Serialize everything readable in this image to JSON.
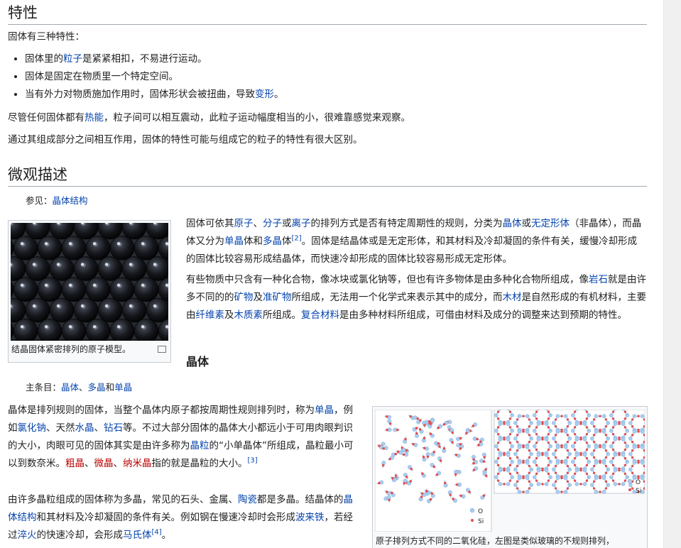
{
  "section_props": {
    "heading": "特性",
    "intro": "固体有三种特性：",
    "bullets": [
      {
        "pre": "固体里的",
        "link": "粒子",
        "post": "是紧紧相扣，不易进行运动。"
      },
      {
        "pre": "固体是固定在物质里一个特定空间。",
        "link": "",
        "post": ""
      },
      {
        "pre": "当有外力对物质施加作用时，固体形状会被扭曲，导致",
        "link": "变形",
        "post": "。"
      }
    ],
    "para2_pre": "尽管任何固体都有",
    "para2_link": "热能",
    "para2_post": "，粒子间可以相互震动，此粒子运动幅度相当的小，很难靠感觉来观察。",
    "para3": "通过其组成部分之间相互作用，固体的特性可能与组成它的粒子的特性有很大区别。"
  },
  "section_micro": {
    "heading": "微观描述",
    "see_also_prefix": "参见：",
    "see_also_link": "晶体结构",
    "thumb_caption": "结晶固体紧密排列的原子模型。",
    "p1": {
      "t1": "固体可依其",
      "l1": "原子",
      "t2": "、",
      "l2": "分子",
      "t3": "或",
      "l3": "离子",
      "t4": "的排列方式是否有特定周期性的规则，分类为",
      "l4": "晶体",
      "t5": "或",
      "l5": "无定形体",
      "t6": "（非晶体），而晶体又分为",
      "l6": "单晶",
      "t7": "体和",
      "l7": "多晶",
      "t8": "体",
      "ref": "[2]",
      "t9": "。固体是结晶体或是无定形体，和其材料及冷却凝固的条件有关，缓慢冷却形成的固体比较容易形成结晶体，而快速冷却形成的固体比较容易形成无定形体。"
    },
    "p2": {
      "t1": "有些物质中只含有一种化合物，像冰块或氯化钠等，但也有许多物体是由多种化合物所组成，像",
      "l1": "岩石",
      "t2": "就是由许多不同的的",
      "l2": "矿物",
      "t3": "及",
      "l3": "准矿物",
      "t4": "所组成，无法用一个化学式来表示其中的成分，而",
      "l4": "木材",
      "t5": "是自然形成的有机材料，主要由",
      "l5": "纤维素",
      "t6": "及",
      "l6": "木质素",
      "t7": "所组成。",
      "l7": "复合材料",
      "t8": "是由多种材料所组成，可借由材料及成分的调整来达到预期的特性。"
    }
  },
  "section_crystal": {
    "heading": "晶体",
    "main_prefix": "主条目：",
    "main_l1": "晶体",
    "main_t1": "、",
    "main_l2": "多晶",
    "main_t2": "和",
    "main_l3": "单晶",
    "p1": {
      "t1": "晶体是排列规则的固体，当整个晶体内原子都按周期性规则排列时，称为",
      "l1": "单晶",
      "t2": "，例如",
      "l2": "氯化钠",
      "t3": "、天然",
      "l3": "水晶",
      "t4": "、",
      "l4": "钻石",
      "t5": "等。不过大部分固体的晶体大小都远小于可用肉眼判识的大小，肉眼可见的固体其实是由许多称为",
      "l5": "晶粒",
      "t6": "的“小单晶体”所组成，晶粒最小可以到数奈米。",
      "n1": "粗晶",
      "t7": "、",
      "n2": "微晶",
      "t8": "、",
      "n3": "纳米晶",
      "t9": "指的就是晶粒的大小。",
      "ref": "[3]"
    },
    "p2": {
      "t1": "由许多晶粒组成的固体称为多晶，常见的石头、金属、",
      "l1": "陶瓷",
      "t2": "都是多晶。结晶体的",
      "l2": "晶体结构",
      "t3": "和其材料及冷却凝固的条件有关。例如钢在慢速冷却时会形成",
      "l3": "波来铁",
      "t4": "，若经过",
      "l4": "淬火",
      "t5": "的快速冷却，会形成",
      "l5": "马氏体",
      "ref": "[4]",
      "t6": "。"
    },
    "figure": {
      "legend_o": "O",
      "legend_si": "Si",
      "caption": "原子排列方式不同的二氧化硅，左图是类似玻璃的不规则排列，"
    }
  },
  "colors": {
    "link": "#0645ad",
    "newlink": "#ba0000",
    "oxygen": "#a9cdf0",
    "silicon": "#e05050"
  }
}
